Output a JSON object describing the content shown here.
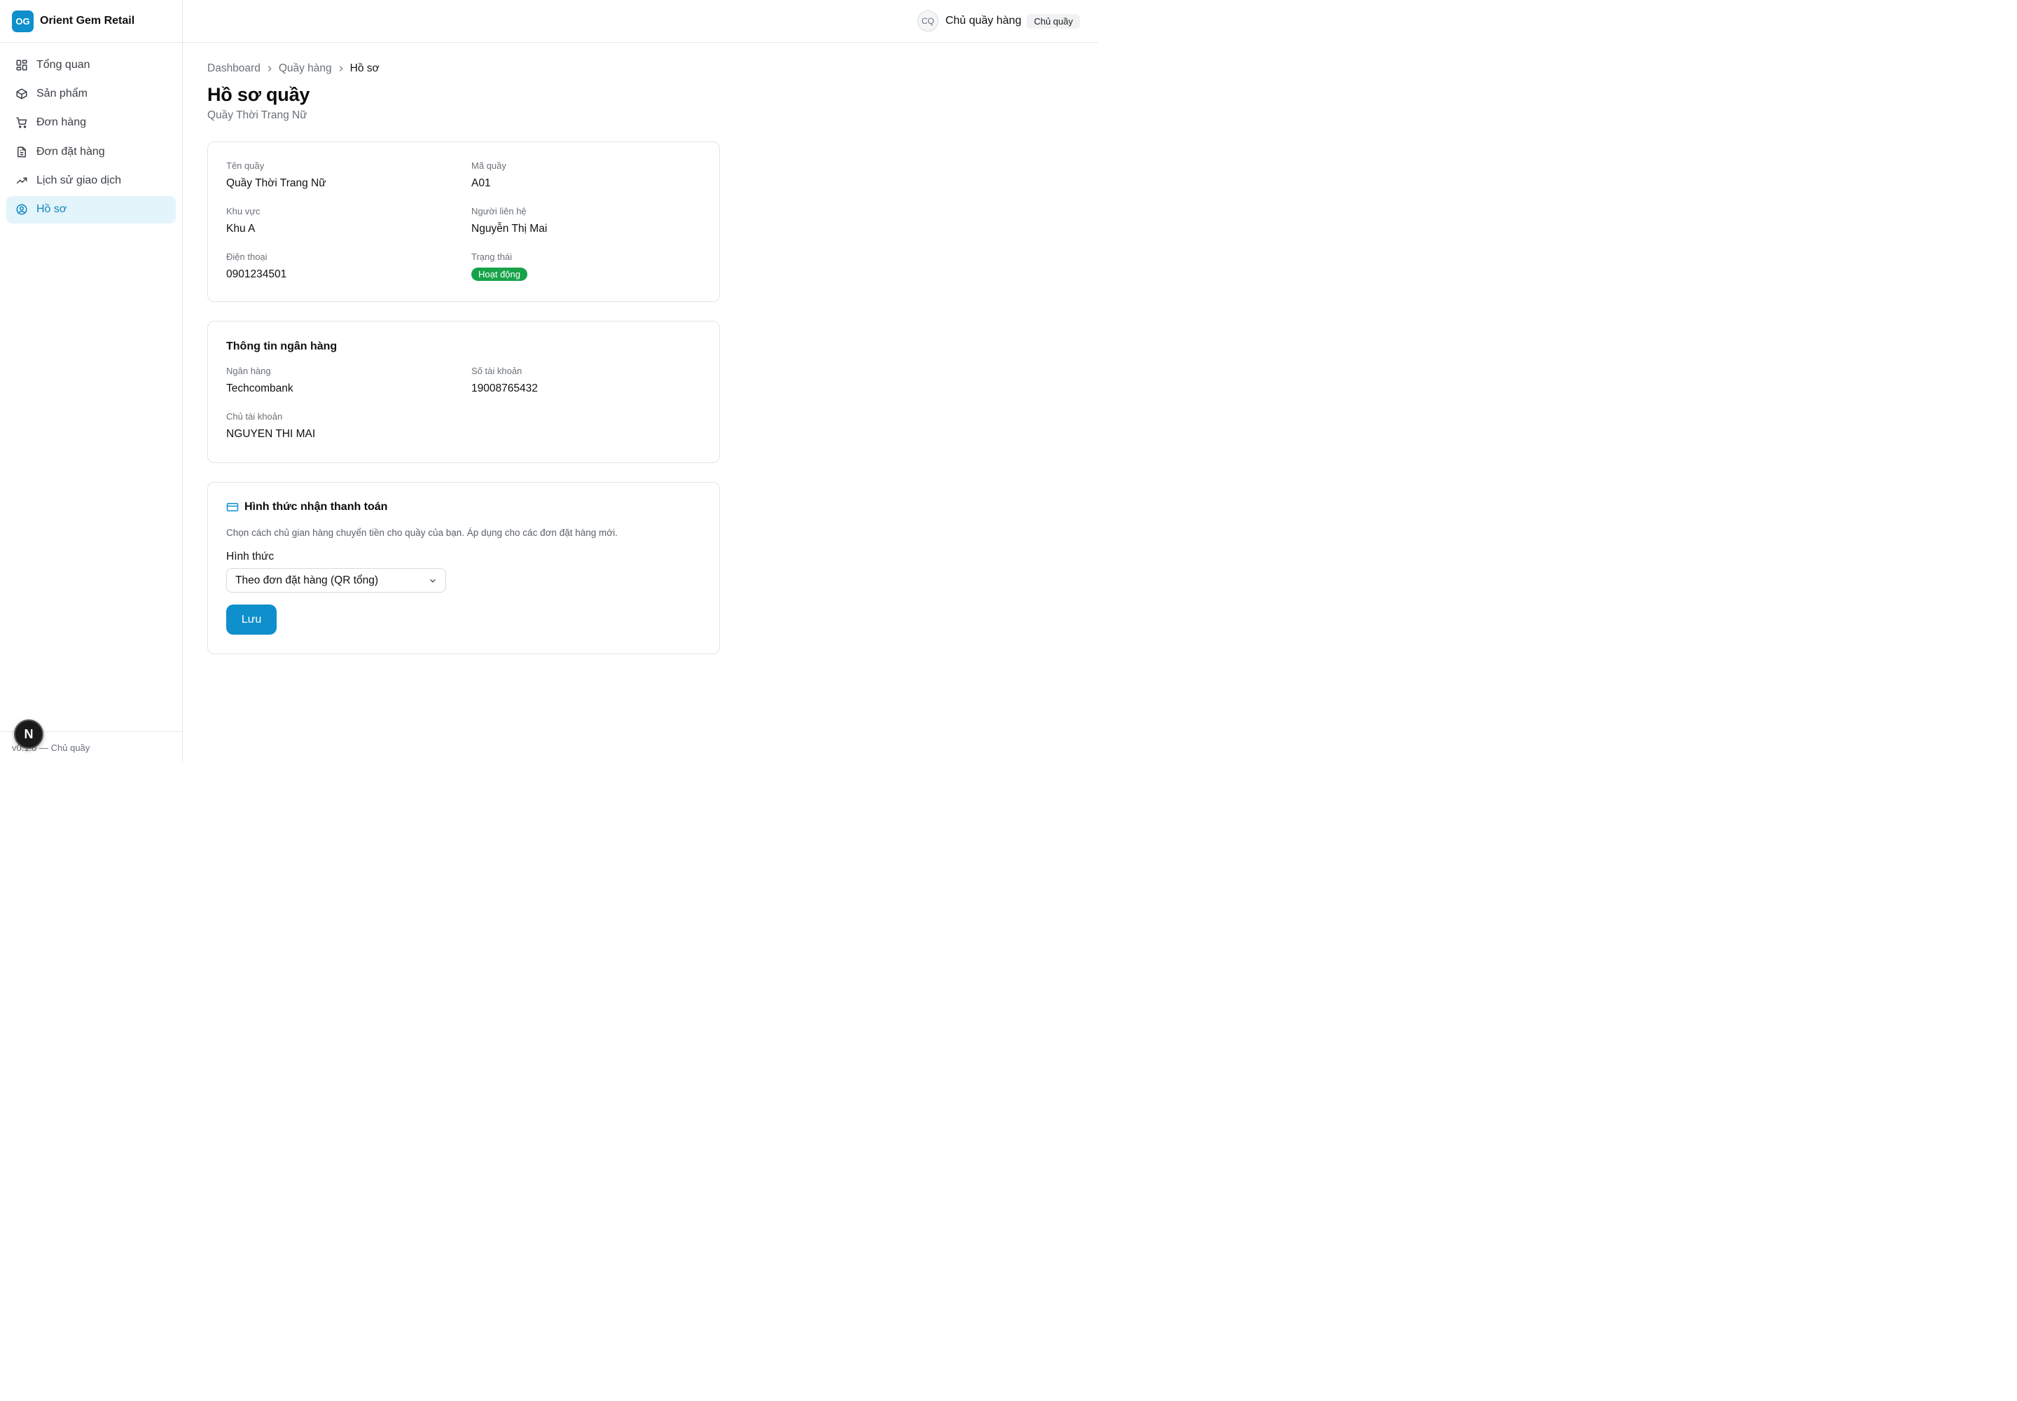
{
  "brand": {
    "logo_text": "OG",
    "name": "Orient Gem Retail",
    "accent": "#0f8fcb"
  },
  "sidebar": {
    "items": [
      {
        "label": "Tổng quan",
        "icon": "dashboard-grid-icon"
      },
      {
        "label": "Sản phẩm",
        "icon": "package-icon"
      },
      {
        "label": "Đơn hàng",
        "icon": "cart-icon"
      },
      {
        "label": "Đơn đặt hàng",
        "icon": "document-icon"
      },
      {
        "label": "Lịch sử giao dịch",
        "icon": "trending-up-icon"
      },
      {
        "label": "Hồ sơ",
        "icon": "user-circle-icon",
        "active": true
      }
    ],
    "footer": "v0.1.0 — Chủ quầy"
  },
  "topbar": {
    "avatar_initials": "CQ",
    "user_name": "Chủ quầy hàng",
    "role": "Chủ quầy"
  },
  "breadcrumb": [
    "Dashboard",
    "Quầy hàng",
    "Hồ sơ"
  ],
  "page": {
    "title": "Hồ sơ quầy",
    "subtitle": "Quầy Thời Trang Nữ"
  },
  "profile": {
    "name_label": "Tên quầy",
    "name_value": "Quầy Thời Trang Nữ",
    "code_label": "Mã quầy",
    "code_value": "A01",
    "area_label": "Khu vực",
    "area_value": "Khu A",
    "contact_label": "Người liên hệ",
    "contact_value": "Nguyễn Thị Mai",
    "phone_label": "Điện thoại",
    "phone_value": "0901234501",
    "status_label": "Trạng thái",
    "status_value": "Hoạt động",
    "status_color": "#16a34a"
  },
  "bank": {
    "title": "Thông tin ngân hàng",
    "bank_label": "Ngân hàng",
    "bank_value": "Techcombank",
    "account_label": "Số tài khoản",
    "account_value": "19008765432",
    "holder_label": "Chủ tài khoản",
    "holder_value": "NGUYEN THI MAI"
  },
  "payment": {
    "title": "Hình thức nhận thanh toán",
    "description": "Chọn cách chủ gian hàng chuyển tiền cho quầy của bạn. Áp dụng cho các đơn đặt hàng mới.",
    "method_label": "Hình thức",
    "method_selected": "Theo đơn đặt hàng (QR tổng)",
    "save_label": "Lưu"
  },
  "dev_badge": "N"
}
